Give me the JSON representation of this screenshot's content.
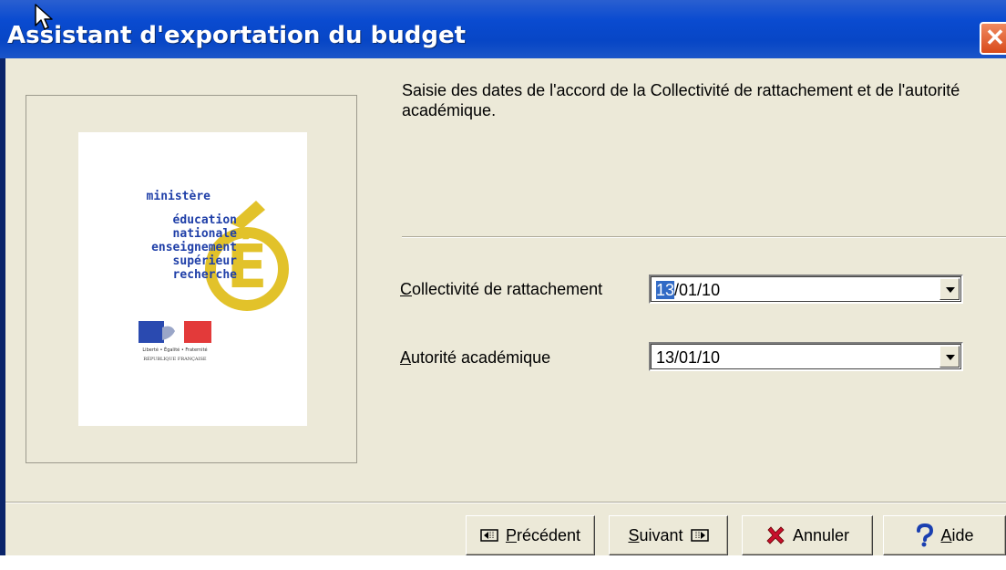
{
  "window": {
    "title": "Assistant d'exportation du budget",
    "close_glyph": "✕"
  },
  "logo": {
    "lines": [
      "ministère",
      "éducation",
      "nationale",
      "enseignement",
      "supérieur",
      "recherche"
    ],
    "letter": "É",
    "motto": "Liberté • Égalité • Fraternité",
    "republic": "RÉPUBLIQUE FRANÇAISE",
    "colors": {
      "text": "#1f3fa8",
      "e_gold": "#e2c22a",
      "flag_blue": "#2a4ab0",
      "flag_red": "#e33a3a"
    }
  },
  "instruction": {
    "text": "Saisie des dates de l'accord de la Collectivité de rattachement et de l'autorité académique."
  },
  "fields": {
    "collectivite": {
      "label_ul": "C",
      "label_rest": "ollectivité de rattachement",
      "value_selected": "13",
      "value_rest": "/01/10"
    },
    "autorite": {
      "label_ul": "A",
      "label_rest": "utorité académique",
      "value": "13/01/10"
    }
  },
  "buttons": {
    "prev": {
      "ul": "P",
      "rest": "récédent",
      "icon": "prev-icon"
    },
    "next": {
      "ul": "S",
      "rest": "uivant",
      "icon": "next-icon"
    },
    "cancel": {
      "label": "Annuler",
      "icon": "red-x-icon",
      "color": "#c8102e"
    },
    "help": {
      "ul": "A",
      "rest": "ide",
      "icon": "question-icon",
      "color": "#1a3fb0"
    }
  }
}
